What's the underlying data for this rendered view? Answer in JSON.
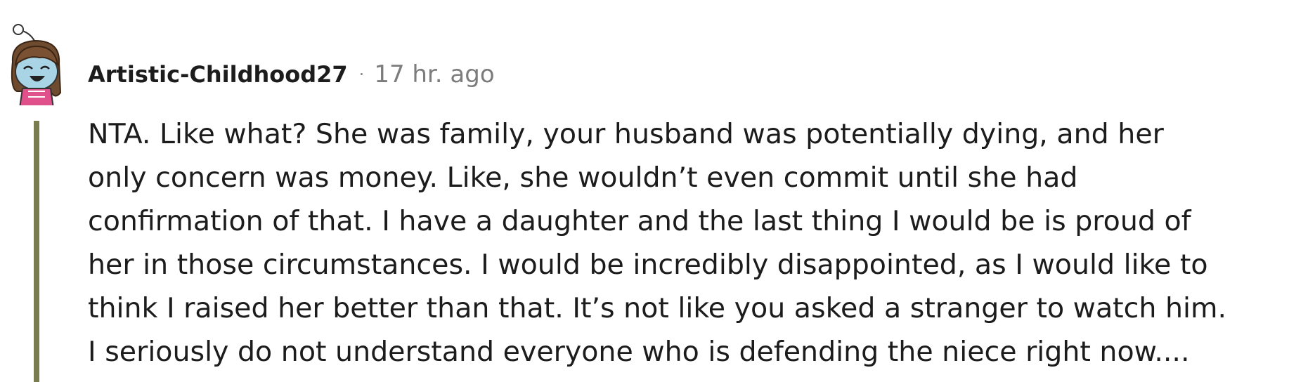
{
  "comment": {
    "author": "Artistic-Childhood27",
    "separator": "·",
    "timestamp": "17 hr. ago",
    "body_lines": [
      "NTA. Like what? She was family, your husband was potentially dying, and her",
      "only concern was money. Like, she wouldn’t even commit until she had",
      "confirmation of that. I have a daughter and the last thing I would be is proud of",
      "her in those circumstances. I would be incredibly disappointed, as I would like to",
      "think I raised her better than that. It’s not like you asked a stranger to watch him.",
      "I seriously do not understand everyone who is defending the niece right now...."
    ],
    "avatar_icon": "snoo-avatar-icon",
    "thread_line_color": "#787c4e"
  }
}
